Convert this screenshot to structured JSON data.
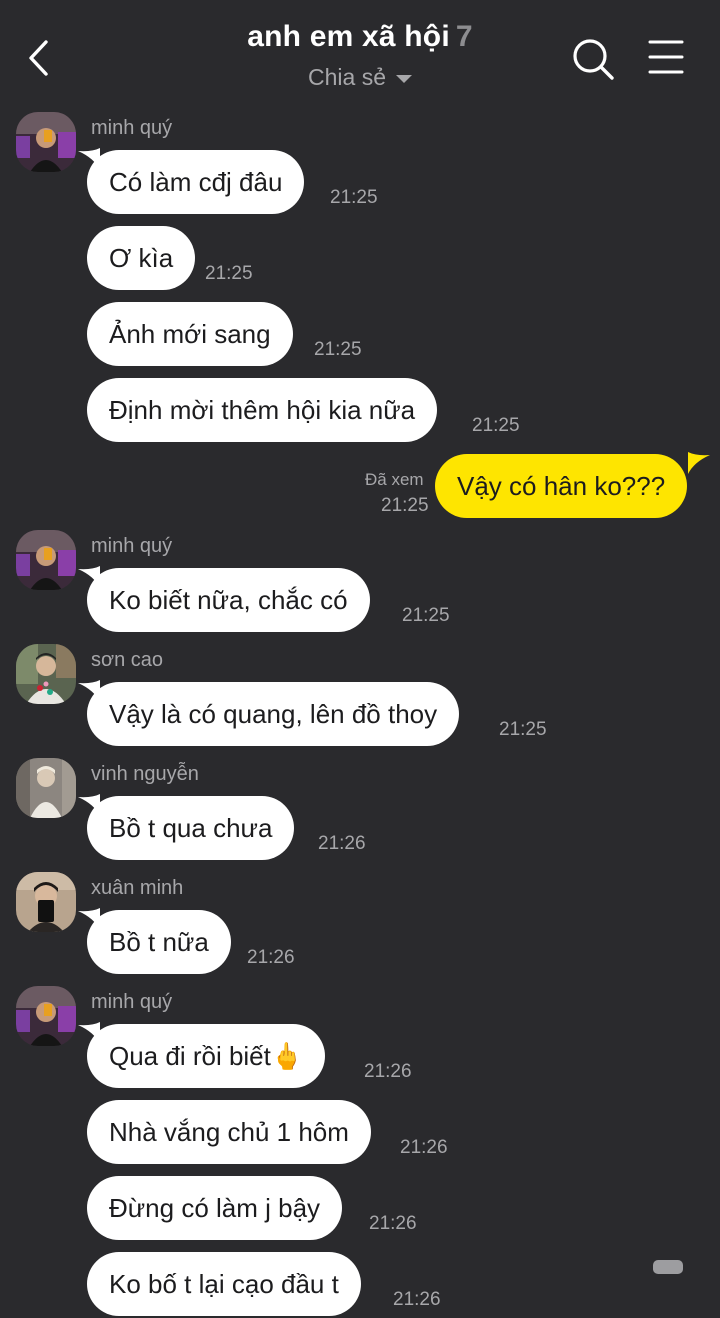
{
  "header": {
    "title": "anh em xã hội",
    "member_count": "7",
    "subtitle": "Chia sẻ"
  },
  "messages": [
    {
      "sender": "minh quý",
      "text": "Có làm cđj đâu",
      "time": "21:25"
    },
    {
      "text": "Ơ kìa",
      "time": "21:25"
    },
    {
      "text": "Ảnh mới sang",
      "time": "21:25"
    },
    {
      "text": "Định mời thêm hội kia nữa",
      "time": "21:25"
    },
    {
      "text": "Vậy có hân ko???",
      "time": "21:25",
      "status": "Đã xem"
    },
    {
      "sender": "minh quý",
      "text": "Ko biết nữa, chắc có",
      "time": "21:25"
    },
    {
      "sender": "sơn cao",
      "text": "Vậy là có quang, lên đồ thoy",
      "time": "21:25"
    },
    {
      "sender": "vinh nguyễn",
      "text": "Bồ t qua chưa",
      "time": "21:26"
    },
    {
      "sender": "xuân minh",
      "text": "Bồ t nữa",
      "time": "21:26"
    },
    {
      "sender": "minh quý",
      "text": "Qua đi rồi biết🖕",
      "time": "21:26"
    },
    {
      "text": "Nhà vắng chủ 1 hôm",
      "time": "21:26"
    },
    {
      "text": "Đừng có làm j bậy",
      "time": "21:26"
    },
    {
      "text": "Ko bố t lại cạo đầu t",
      "time": "21:26"
    }
  ],
  "colors": {
    "background": "#2a2a2d",
    "incoming_bubble": "#ffffff",
    "outgoing_bubble": "#fee500",
    "muted_text": "#a7a7aa"
  },
  "icons": {
    "back": "back-arrow-icon",
    "search": "search-icon",
    "menu": "menu-icon",
    "dropdown": "caret-down-icon"
  }
}
